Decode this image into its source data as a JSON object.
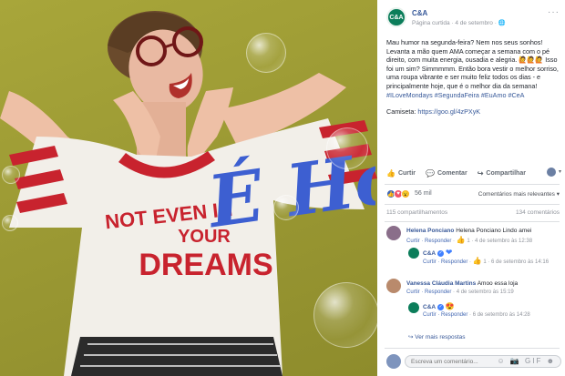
{
  "photo": {
    "shirt_lines": [
      "NOT EVEN IN",
      "YOUR",
      "DREAMS"
    ],
    "overlay": "É Hoje"
  },
  "post": {
    "page_avatar": "C&A",
    "page_name": "C&A",
    "meta": "Página curtida · 4 de setembro · 🌐",
    "more_icon": "···",
    "text_p1": "Mau humor na segunda-feira? Nem nos seus sonhos! Levanta a mão quem AMA começar a semana com o pé direito, com muita energia, ousadia e alegria. 🙋🙋🙋 Isso foi um sim? Simmmmm. Então bora vestir o melhor sorriso, uma roupa vibrante e ser muito feliz todos os dias - e principalmente hoje, que é o melhor dia da semana!",
    "hashtags": "#ILoveMondays #SegundaFeira #EuAmo #CeA",
    "camiseta_label": "Camiseta: ",
    "camiseta_link": "https://goo.gl/4zPXyK"
  },
  "actions": {
    "like": "Curtir",
    "comment": "Comentar",
    "share": "Compartilhar",
    "like_icon": "👍",
    "comment_icon": "💬",
    "share_icon": "↪",
    "caret": "▾"
  },
  "stats": {
    "reactions_count": "56 mil",
    "sort_label": "Comentários mais relevantes ▾",
    "shares": "115 compartilhamentos",
    "comments_count": "134 comentários"
  },
  "comments": [
    {
      "author": "Helena Ponciano",
      "text": "Helena Ponciano Lindo amei",
      "actions": "Curtir · Responder",
      "likes": "1",
      "time": "4 de setembro às 12:38"
    },
    {
      "author": "C&A",
      "text": "❤",
      "actions": "Curtir · Responder",
      "likes": "1",
      "time": "6 de setembro às 14:16"
    },
    {
      "author": "Vanessa Cláudia Martins",
      "text": "Amoo essa loja",
      "actions": "Curtir · Responder",
      "time": "4 de setembro às 15:19"
    },
    {
      "author": "C&A",
      "text": "😍",
      "actions": "Curtir · Responder",
      "time": "6 de setembro às 14:28"
    }
  ],
  "more_replies": "↪ Ver mais respostas",
  "composer": {
    "placeholder": "Escreva um comentário...",
    "icons": "☺ 📷 GIF ☻"
  }
}
